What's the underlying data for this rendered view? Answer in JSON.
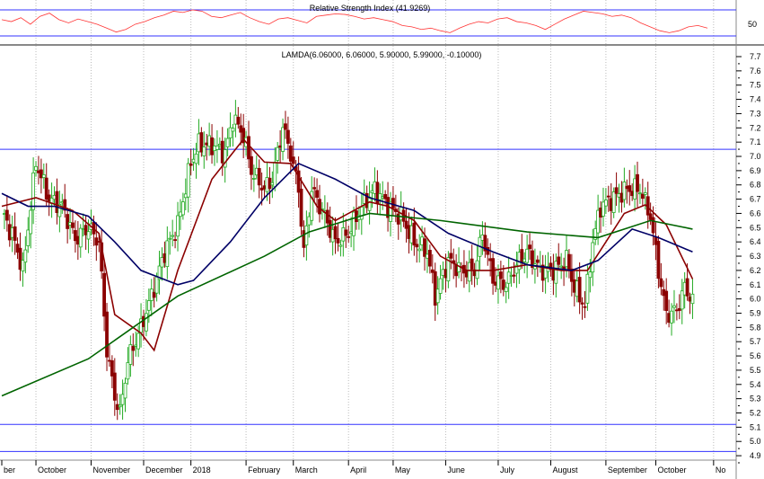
{
  "chart_data": {
    "type": "candlestick",
    "title": "LAMDA(6.06000, 6.06000, 5.90000, 5.99000, -0.10000)",
    "ohlc_last": {
      "open": 6.06,
      "high": 6.06,
      "low": 5.9,
      "close": 5.99,
      "change": -0.1
    },
    "ylim": [
      4.85,
      7.75
    ],
    "yticks": [
      7.7,
      7.6,
      7.5,
      7.4,
      7.3,
      7.2,
      7.1,
      7.0,
      6.9,
      6.8,
      6.7,
      6.6,
      6.5,
      6.4,
      6.3,
      6.2,
      6.1,
      6.0,
      5.9,
      5.8,
      5.7,
      5.6,
      5.5,
      5.4,
      5.3,
      5.2,
      5.1,
      5.0,
      4.9
    ],
    "xlim_days": [
      0,
      273
    ],
    "months": [
      {
        "label": "ber",
        "day": 0
      },
      {
        "label": "October",
        "day": 13
      },
      {
        "label": "November",
        "day": 34
      },
      {
        "label": "December",
        "day": 54
      },
      {
        "label": "2018",
        "day": 72
      },
      {
        "label": "February",
        "day": 93
      },
      {
        "label": "March",
        "day": 111
      },
      {
        "label": "April",
        "day": 132
      },
      {
        "label": "May",
        "day": 149
      },
      {
        "label": "June",
        "day": 169
      },
      {
        "label": "July",
        "day": 189
      },
      {
        "label": "August",
        "day": 209
      },
      {
        "label": "September",
        "day": 230
      },
      {
        "label": "October",
        "day": 249
      },
      {
        "label": "No",
        "day": 271
      }
    ],
    "hlines": [
      7.05,
      5.12,
      4.93
    ],
    "closes_keypoints": [
      [
        1,
        6.58
      ],
      [
        5,
        6.4
      ],
      [
        8,
        6.2
      ],
      [
        13,
        6.96
      ],
      [
        18,
        6.7
      ],
      [
        23,
        6.65
      ],
      [
        28,
        6.42
      ],
      [
        33,
        6.5
      ],
      [
        37,
        6.4
      ],
      [
        40,
        5.64
      ],
      [
        43,
        5.32
      ],
      [
        45,
        5.2
      ],
      [
        48,
        5.57
      ],
      [
        53,
        5.8
      ],
      [
        58,
        6.08
      ],
      [
        62,
        6.33
      ],
      [
        67,
        6.52
      ],
      [
        72,
        6.96
      ],
      [
        75,
        7.08
      ],
      [
        80,
        7.08
      ],
      [
        85,
        7.02
      ],
      [
        88,
        7.27
      ],
      [
        92,
        7.15
      ],
      [
        95,
        6.9
      ],
      [
        100,
        6.77
      ],
      [
        103,
        6.84
      ],
      [
        107,
        7.21
      ],
      [
        110,
        7.02
      ],
      [
        113,
        6.77
      ],
      [
        115,
        6.33
      ],
      [
        118,
        6.77
      ],
      [
        123,
        6.58
      ],
      [
        127,
        6.4
      ],
      [
        132,
        6.46
      ],
      [
        137,
        6.65
      ],
      [
        142,
        6.77
      ],
      [
        147,
        6.65
      ],
      [
        152,
        6.58
      ],
      [
        157,
        6.4
      ],
      [
        162,
        6.33
      ],
      [
        165,
        6.02
      ],
      [
        170,
        6.27
      ],
      [
        175,
        6.2
      ],
      [
        180,
        6.2
      ],
      [
        183,
        6.46
      ],
      [
        187,
        6.14
      ],
      [
        192,
        6.1
      ],
      [
        197,
        6.27
      ],
      [
        200,
        6.33
      ],
      [
        205,
        6.2
      ],
      [
        210,
        6.2
      ],
      [
        215,
        6.27
      ],
      [
        218,
        6.08
      ],
      [
        222,
        5.95
      ],
      [
        225,
        6.4
      ],
      [
        228,
        6.65
      ],
      [
        233,
        6.71
      ],
      [
        238,
        6.77
      ],
      [
        243,
        6.77
      ],
      [
        247,
        6.58
      ],
      [
        250,
        6.2
      ],
      [
        253,
        5.89
      ],
      [
        257,
        5.92
      ],
      [
        260,
        6.08
      ],
      [
        263,
        5.99
      ]
    ],
    "series": [
      {
        "name": "MA short",
        "color": "#8b0000",
        "points": [
          [
            0,
            6.65
          ],
          [
            13,
            6.71
          ],
          [
            27,
            6.62
          ],
          [
            37,
            6.46
          ],
          [
            43,
            5.89
          ],
          [
            53,
            5.76
          ],
          [
            58,
            5.64
          ],
          [
            67,
            6.2
          ],
          [
            80,
            6.84
          ],
          [
            92,
            7.12
          ],
          [
            100,
            6.96
          ],
          [
            110,
            6.95
          ],
          [
            120,
            6.65
          ],
          [
            127,
            6.55
          ],
          [
            140,
            6.68
          ],
          [
            147,
            6.65
          ],
          [
            157,
            6.55
          ],
          [
            167,
            6.3
          ],
          [
            177,
            6.2
          ],
          [
            187,
            6.2
          ],
          [
            200,
            6.24
          ],
          [
            213,
            6.2
          ],
          [
            223,
            6.2
          ],
          [
            230,
            6.4
          ],
          [
            237,
            6.6
          ],
          [
            245,
            6.66
          ],
          [
            253,
            6.52
          ],
          [
            263,
            6.14
          ]
        ]
      },
      {
        "name": "MA medium",
        "color": "#000066",
        "points": [
          [
            0,
            6.74
          ],
          [
            10,
            6.65
          ],
          [
            20,
            6.65
          ],
          [
            33,
            6.58
          ],
          [
            43,
            6.4
          ],
          [
            53,
            6.2
          ],
          [
            67,
            6.1
          ],
          [
            73,
            6.13
          ],
          [
            87,
            6.4
          ],
          [
            100,
            6.71
          ],
          [
            113,
            6.95
          ],
          [
            127,
            6.84
          ],
          [
            140,
            6.71
          ],
          [
            157,
            6.62
          ],
          [
            170,
            6.46
          ],
          [
            187,
            6.33
          ],
          [
            200,
            6.24
          ],
          [
            217,
            6.2
          ],
          [
            227,
            6.27
          ],
          [
            240,
            6.49
          ],
          [
            250,
            6.43
          ],
          [
            263,
            6.33
          ]
        ]
      },
      {
        "name": "MA long",
        "color": "#006400",
        "points": [
          [
            0,
            5.32
          ],
          [
            33,
            5.58
          ],
          [
            67,
            6.02
          ],
          [
            100,
            6.3
          ],
          [
            117,
            6.47
          ],
          [
            140,
            6.6
          ],
          [
            167,
            6.55
          ],
          [
            200,
            6.47
          ],
          [
            227,
            6.43
          ],
          [
            247,
            6.55
          ],
          [
            263,
            6.49
          ]
        ]
      }
    ],
    "rsi": {
      "title": "Relative Strength Index (41.9269)",
      "level_label": "50",
      "bands": [
        70,
        30
      ],
      "values": [
        55,
        52,
        58,
        48,
        60,
        65,
        55,
        50,
        56,
        52,
        48,
        42,
        36,
        40,
        48,
        52,
        58,
        62,
        68,
        66,
        70,
        68,
        60,
        58,
        62,
        66,
        58,
        52,
        48,
        56,
        58,
        54,
        50,
        60,
        62,
        64,
        63,
        60,
        56,
        58,
        55,
        52,
        46,
        44,
        40,
        42,
        38,
        35,
        42,
        48,
        52,
        50,
        56,
        58,
        52,
        50,
        46,
        40,
        48,
        56,
        62,
        68,
        66,
        64,
        60,
        62,
        58,
        50,
        44,
        38,
        35,
        38,
        44,
        46,
        42
      ]
    }
  }
}
